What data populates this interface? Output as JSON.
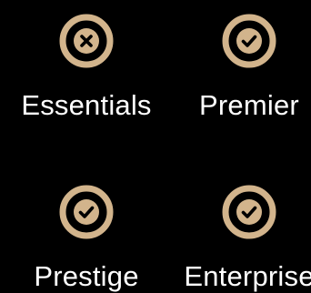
{
  "colors": {
    "background": "#000000",
    "accent": "#d2b48c",
    "label": "#ffffff"
  },
  "tiers": [
    {
      "label": "Essentials",
      "icon": "x-circle-icon",
      "included": false
    },
    {
      "label": "Premier",
      "icon": "check-circle-icon",
      "included": true
    },
    {
      "label": "Prestige",
      "icon": "check-circle-icon",
      "included": true
    },
    {
      "label": "Enterprise",
      "icon": "check-circle-icon",
      "included": true
    }
  ]
}
